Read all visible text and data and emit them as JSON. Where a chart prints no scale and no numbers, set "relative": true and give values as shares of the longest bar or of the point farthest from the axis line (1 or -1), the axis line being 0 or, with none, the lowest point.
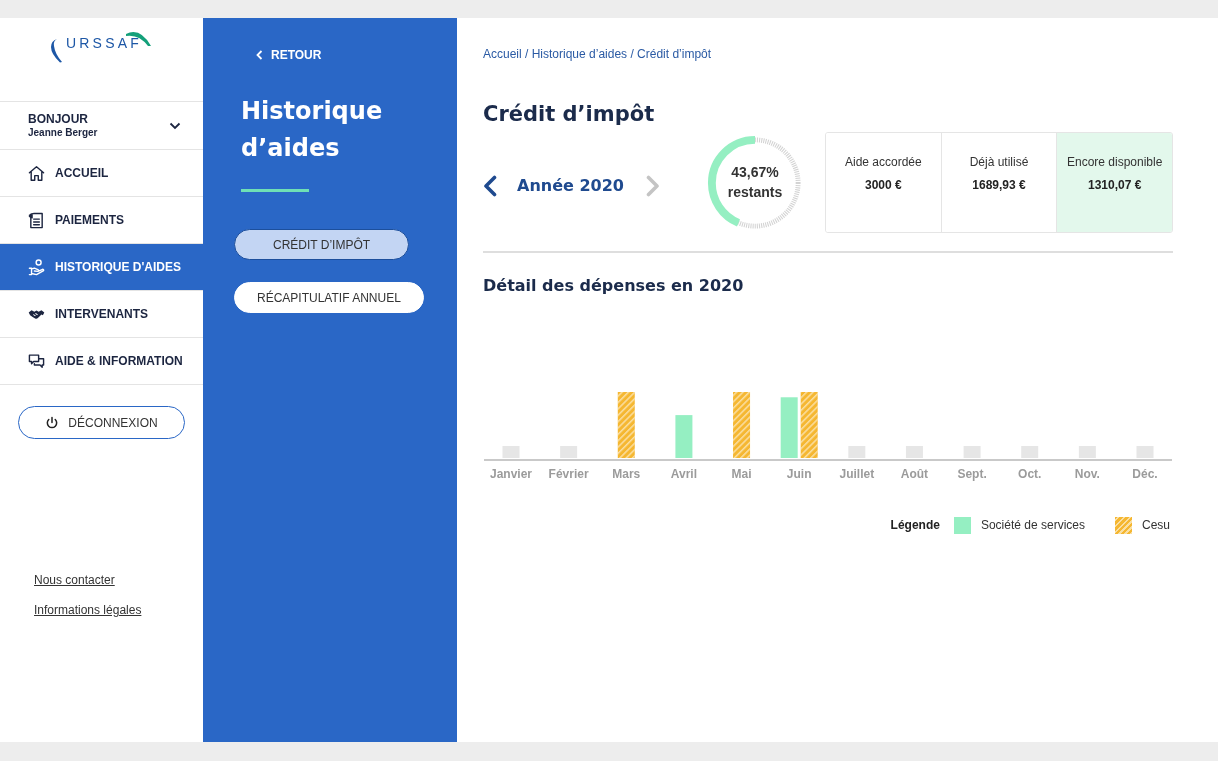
{
  "sidebar": {
    "logo": "URSSAF",
    "user": {
      "greeting": "BONJOUR",
      "name": "Jeanne Berger"
    },
    "items": [
      {
        "label": "ACCUEIL",
        "selected": false
      },
      {
        "label": "PAIEMENTS",
        "selected": false
      },
      {
        "label": "HISTORIQUE D'AIDES",
        "selected": true
      },
      {
        "label": "INTERVENANTS",
        "selected": false
      },
      {
        "label": "AIDE & INFORMATION",
        "selected": false
      }
    ],
    "logout": "DÉCONNEXION",
    "links": [
      "Nous contacter",
      "Informations légales"
    ]
  },
  "section_panel": {
    "back": "RETOUR",
    "title": "Historique d’aides",
    "tabs": [
      {
        "label": "CRÉDIT D’IMPÔT",
        "selected": true
      },
      {
        "label": "RÉCAPITULATIF ANNUEL",
        "selected": false
      }
    ]
  },
  "content": {
    "breadcrumb": "Accueil / Historique d’aides / Crédit d’impôt",
    "title": "Crédit d’impôt",
    "year_nav": {
      "label": "Année 2020",
      "prev_disabled": false,
      "next_disabled": true
    },
    "remaining": {
      "level": 0.4367,
      "value": "43,67%",
      "caption": "restants"
    },
    "summary": [
      {
        "label": "Aide accordée",
        "value": "3000 €",
        "highlighted": false
      },
      {
        "label": "Déjà utilisé",
        "value": "1689,93 €",
        "highlighted": false
      },
      {
        "label": "Encore disponible",
        "value": "1310,07 €",
        "highlighted": true
      }
    ],
    "expenses": {
      "title": "Détail des dépenses en 2020",
      "chart_data": {
        "type": "bar",
        "relative": true,
        "categories": [
          "Janvier",
          "Février",
          "Mars",
          "Avril",
          "Mai",
          "Juin",
          "Juillet",
          "Août",
          "Sept.",
          "Oct.",
          "Nov.",
          "Déc."
        ],
        "series": [
          {
            "name": "Société de services",
            "color": "#95efc2",
            "values": [
              0,
              0,
              0,
              0.65,
              0,
              0.92,
              0,
              0,
              0,
              0,
              0,
              0
            ]
          },
          {
            "name": "Cesu",
            "color": "#f5b731",
            "values": [
              0,
              0,
              1,
              0,
              1,
              1,
              0,
              0,
              0,
              0,
              0,
              0
            ]
          }
        ]
      },
      "legend_title": "Légende"
    }
  }
}
